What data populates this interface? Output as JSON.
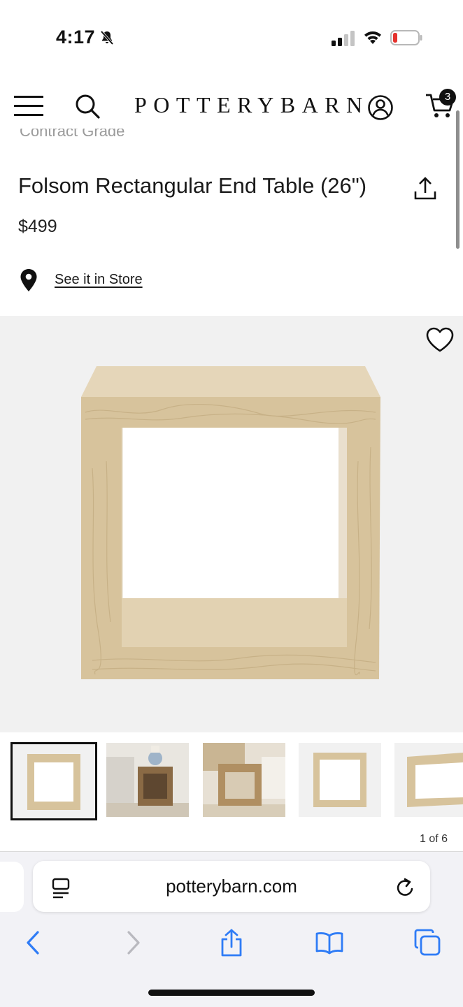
{
  "status_bar": {
    "time": "4:17"
  },
  "header": {
    "brand": "POTTERYBARN",
    "cart_count": "3"
  },
  "scrolled_partial_text": "Contract Grade",
  "product": {
    "title": "Folsom Rectangular End Table (26\")",
    "price": "$499",
    "store_link": "See it in Store"
  },
  "gallery": {
    "counter": "1 of 6",
    "selected_index": 1
  },
  "browser": {
    "url": "potterybarn.com"
  },
  "colors": {
    "accent_blue": "#2f7cf6",
    "wood": "#d8c7a4",
    "background_gray": "#f1f1f1"
  }
}
